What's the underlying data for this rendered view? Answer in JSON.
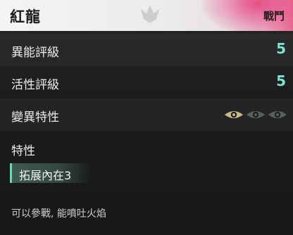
{
  "header": {
    "name": "紅龍",
    "type": "戰鬥",
    "emblem_icon": "dragon-wing-emblem-icon",
    "accent_color": "#e8407a"
  },
  "stats": [
    {
      "label": "異能評級",
      "value": "5"
    },
    {
      "label": "活性評級",
      "value": "5"
    },
    {
      "label": "變異特性",
      "eyes_active": 1,
      "eyes_total": 3
    }
  ],
  "traits": {
    "title": "特性",
    "items": [
      "拓展內在3"
    ]
  },
  "description": "可以參戰, 能噴吐火焰",
  "colors": {
    "value": "#7fe3c8",
    "eye_active": "#c9b98a",
    "eye_inactive": "#5c5f60",
    "chip": "#3f5a52"
  }
}
